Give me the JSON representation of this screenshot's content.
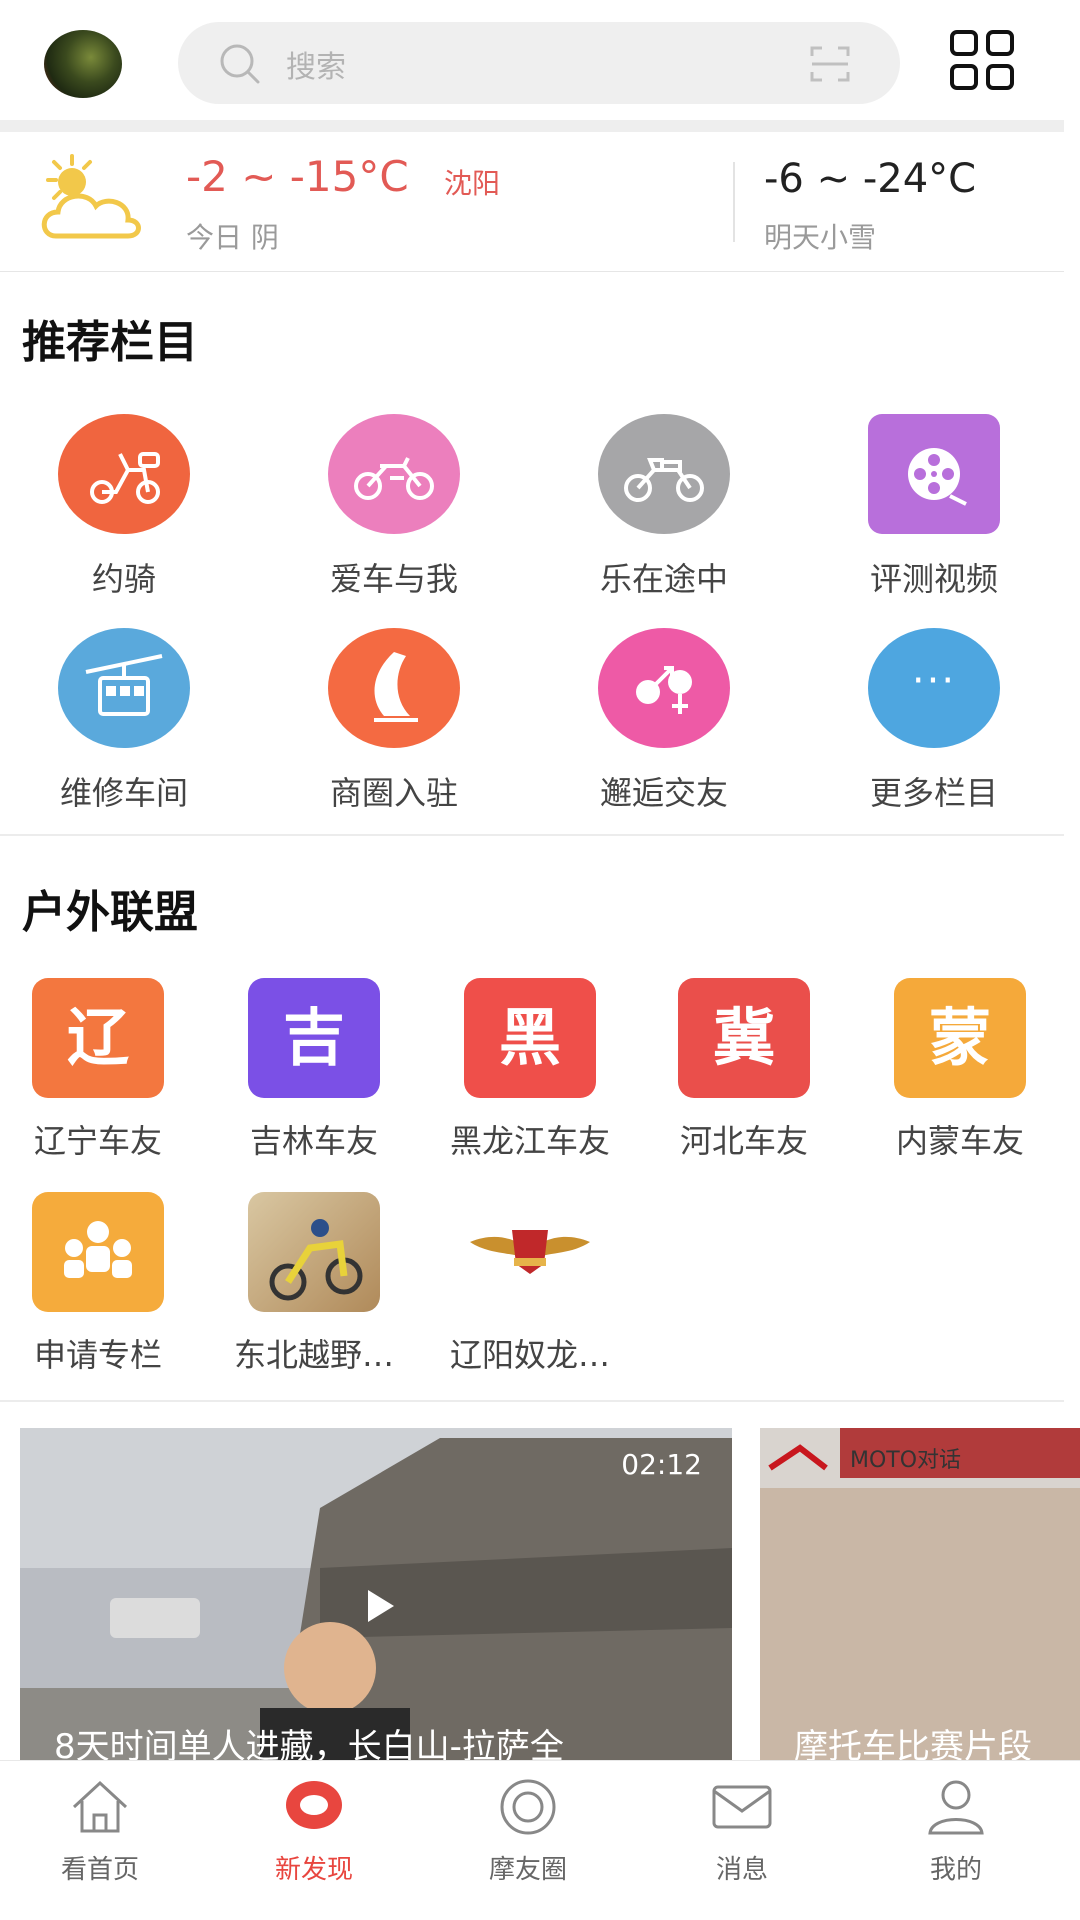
{
  "header": {
    "search_placeholder": "搜索"
  },
  "weather": {
    "today_temp": "-2 ~ -15°C",
    "city": "沈阳",
    "today_label": "今日 阴",
    "tomorrow_temp": "-6 ~ -24°C",
    "tomorrow_label": "明天小雪"
  },
  "recommended": {
    "title": "推荐栏目",
    "items": [
      {
        "label": "约骑",
        "color": "#f0653f"
      },
      {
        "label": "爱车与我",
        "color": "#ec7fbd"
      },
      {
        "label": "乐在途中",
        "color": "#a6a6a8"
      },
      {
        "label": "评测视频",
        "color": "#b86fdb"
      },
      {
        "label": "维修车间",
        "color": "#5aa9dc"
      },
      {
        "label": "商圈入驻",
        "color": "#f46a42"
      },
      {
        "label": "邂逅交友",
        "color": "#ee5aa6"
      },
      {
        "label": "更多栏目",
        "color": "#4ea6e0",
        "glyph": "···"
      }
    ]
  },
  "alliance": {
    "title": "户外联盟",
    "items": [
      {
        "label": "辽宁车友",
        "glyph": "辽",
        "color": "#f3773f"
      },
      {
        "label": "吉林车友",
        "glyph": "吉",
        "color": "#7b50e6"
      },
      {
        "label": "黑龙江车友",
        "glyph": "黑",
        "color": "#ef4f4a"
      },
      {
        "label": "河北车友",
        "glyph": "冀",
        "color": "#ea4f4b"
      },
      {
        "label": "内蒙车友",
        "glyph": "蒙",
        "color": "#f5a93a"
      },
      {
        "label": "申请专栏"
      },
      {
        "label": "东北越野…"
      },
      {
        "label": "辽阳奴龙…"
      }
    ]
  },
  "videos": [
    {
      "duration": "02:12",
      "caption": "8天时间单人进藏，长白山-拉萨全"
    },
    {
      "logo_text": "MOTO对话",
      "caption": "摩托车比赛片段"
    }
  ],
  "bottom_nav": {
    "active_color": "#e8463f",
    "items": [
      {
        "label": "看首页"
      },
      {
        "label": "新发现"
      },
      {
        "label": "摩友圈"
      },
      {
        "label": "消息"
      },
      {
        "label": "我的"
      }
    ]
  }
}
